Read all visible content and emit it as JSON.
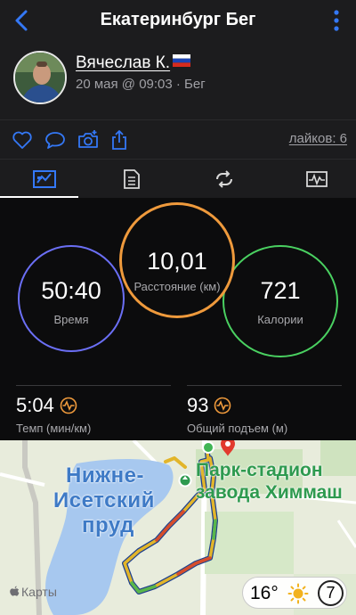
{
  "header": {
    "title": "Екатеринбург Бег",
    "back_icon": "chevron-left-icon",
    "more_icon": "more-vertical-icon"
  },
  "profile": {
    "name": "Вячеслав К.",
    "date_line": "20 мая @ 09:03 · Бег"
  },
  "actions": {
    "likes": "лайков: 6",
    "icons": [
      "heart-icon",
      "comment-icon",
      "camera-add-icon",
      "share-icon"
    ]
  },
  "tabs": [
    {
      "icon": "summary-icon",
      "active": true
    },
    {
      "icon": "list-icon",
      "active": false
    },
    {
      "icon": "laps-icon",
      "active": false
    },
    {
      "icon": "chart-icon",
      "active": false
    }
  ],
  "stats": {
    "distance": {
      "value": "10,01",
      "label": "Расстояние (км)"
    },
    "time": {
      "value": "50:40",
      "label": "Время"
    },
    "calories": {
      "value": "721",
      "label": "Калории"
    },
    "pace": {
      "value": "5:04",
      "label": "Темп (мин/км)"
    },
    "elevation": {
      "value": "93",
      "label": "Общий подъем (м)"
    }
  },
  "map": {
    "lake_label_1": "Нижне-",
    "lake_label_2": "Исетский",
    "lake_label_3": "пруд",
    "poi_label_1": "Парк-стадион",
    "poi_label_2": "завода Химмаш",
    "brand": "Карты",
    "temperature": "16°",
    "aqi": "7"
  },
  "colors": {
    "accent_blue": "#3478f6",
    "time_ring": "#6b6ff5",
    "distance_ring": "#ef9a3c",
    "calories_ring": "#4ad161"
  }
}
